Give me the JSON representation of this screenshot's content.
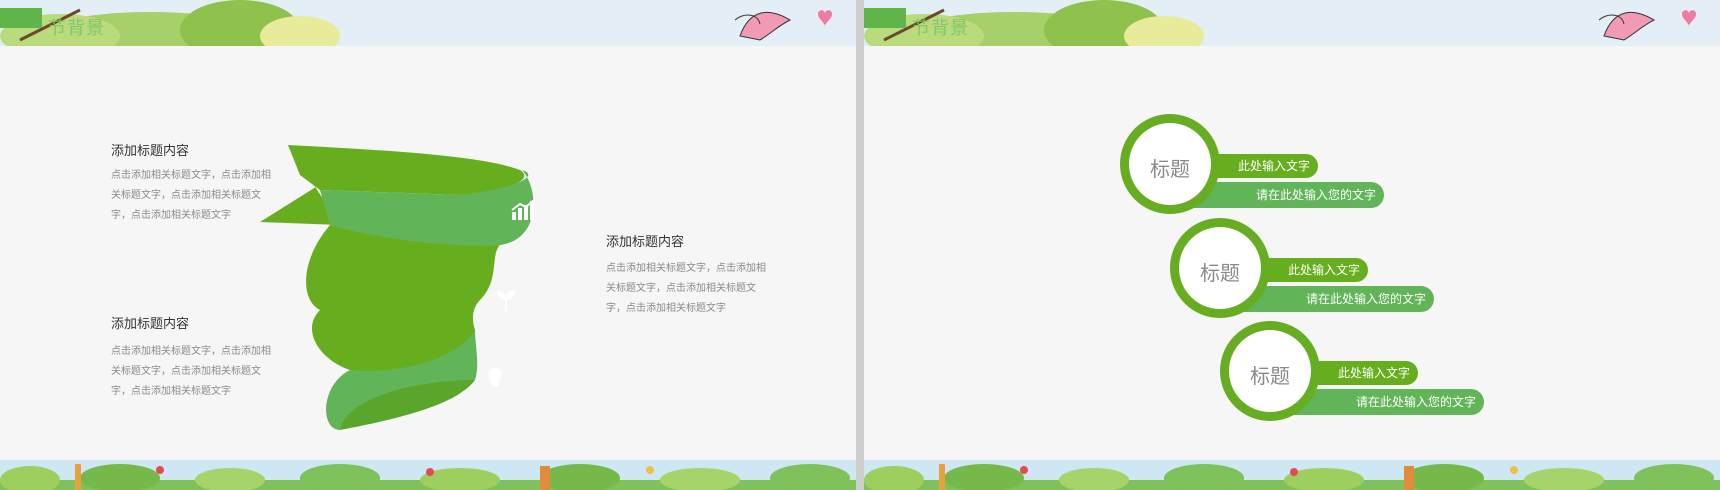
{
  "colors": {
    "green_dark": "#66ad22",
    "green_mid": "#62b458",
    "text_dark": "#333333",
    "text_muted": "#8a8a8a"
  },
  "left_slide": {
    "banner_title": "节背景",
    "blocks": [
      {
        "heading": "添加标题内容",
        "text": "点击添加相关标题文字，点击添加相关标题文字，点击添加相关标题文字，点击添加相关标题文字"
      },
      {
        "heading": "添加标题内容",
        "text": "点击添加相关标题文字，点击添加相关标题文字，点击添加相关标题文字，点击添加相关标题文字"
      },
      {
        "heading": "添加标题内容",
        "text": "点击添加相关标题文字，点击添加相关标题文字，点击添加相关标题文字，点击添加相关标题文字"
      }
    ],
    "icons": [
      "growth-chart-icon",
      "sprout-icon",
      "lightbulb-icon"
    ]
  },
  "right_slide": {
    "banner_title": "节背景",
    "items": [
      {
        "title": "标题",
        "line1": "此处输入文字",
        "line2": "请在此处输入您的文字"
      },
      {
        "title": "标题",
        "line1": "此处输入文字",
        "line2": "请在此处输入您的文字"
      },
      {
        "title": "标题",
        "line1": "此处输入文字",
        "line2": "请在此处输入您的文字"
      }
    ]
  }
}
